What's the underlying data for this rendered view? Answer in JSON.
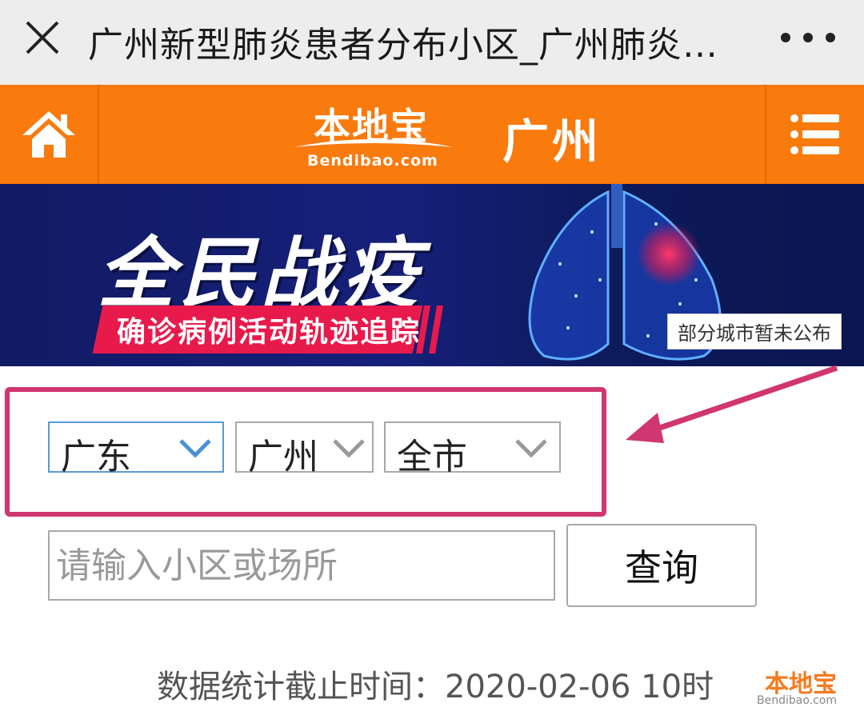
{
  "titlebar": {
    "title": "广州新型肺炎患者分布小区_广州肺炎…"
  },
  "navbar": {
    "logo_cn": "本地宝",
    "logo_en": "Bendibao.com",
    "city": "广州"
  },
  "banner": {
    "headline": "全民战疫",
    "subtitle": "确诊病例活动轨迹追踪",
    "note": "部分城市暂未公布"
  },
  "filters": {
    "province": "广东",
    "city": "广州",
    "district": "全市"
  },
  "search": {
    "placeholder": "请输入小区或场所",
    "button_label": "查询"
  },
  "stats": {
    "update_time": "数据统计截止时间：2020-02-06 10时"
  },
  "watermark": {
    "cn": "本地宝",
    "en": "Bendibao.com"
  },
  "colors": {
    "nav_orange": "#f97a0d",
    "highlight_pink": "#d0366f",
    "banner_blue": "#16207a",
    "banner_red": "#e8194b"
  }
}
